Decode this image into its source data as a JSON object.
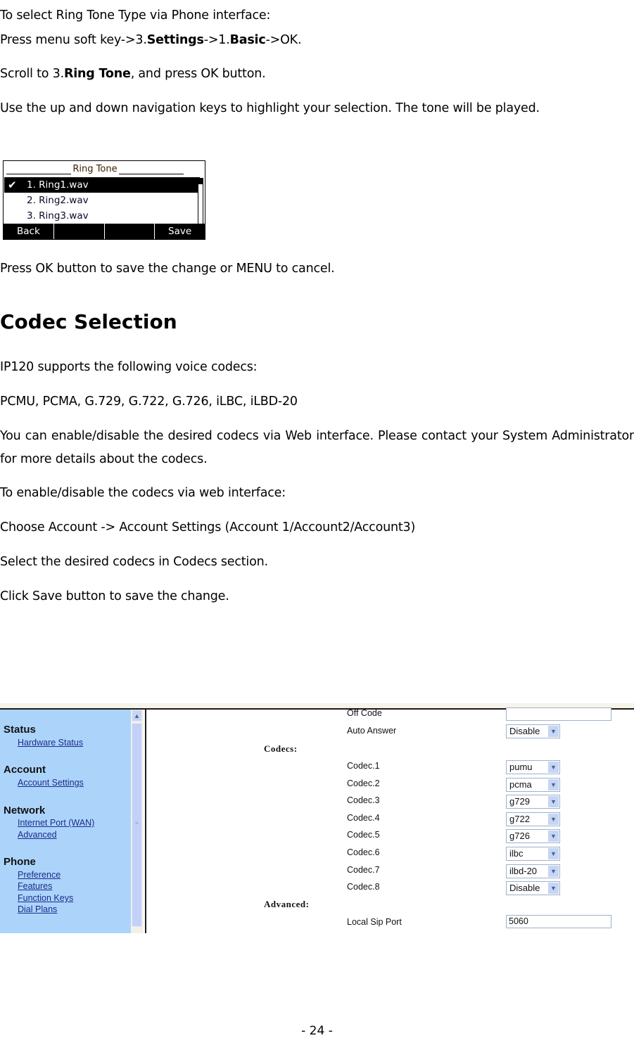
{
  "intro": {
    "line1": "To select Ring Tone Type via Phone interface:",
    "step1": {
      "prefix": "Press menu soft key->3.",
      "b1": "Settings",
      "mid": "->1.",
      "b2": "Basic",
      "suffix": "->OK."
    },
    "step2": {
      "prefix": "Scroll to 3.",
      "b1": "Ring Tone",
      "suffix": ", and press OK button."
    },
    "step3": "Use the up and down navigation keys to highlight your selection. The tone will be played."
  },
  "lcd": {
    "title": "Ring Tone",
    "check_icon": "✔",
    "items": [
      {
        "label": "1. Ring1.wav",
        "selected": true
      },
      {
        "label": "2. Ring2.wav",
        "selected": false
      },
      {
        "label": "3. Ring3.wav",
        "selected": false
      }
    ],
    "softkeys": [
      "Back",
      "",
      "",
      "Save"
    ]
  },
  "after_lcd": "Press OK button to save the change or MENU to cancel.",
  "codec_section": {
    "heading": "Codec Selection",
    "p1": "IP120 supports the following voice codecs:",
    "p2": "PCMU, PCMA, G.729, G.722, G.726, iLBC, iLBD-20",
    "p3": "You can enable/disable the desired codecs via Web interface. Please contact your System Administrator for more details about the codecs.",
    "p4": "To enable/disable the codecs via web interface:",
    "p5": "Choose Account -> Account Settings (Account 1/Account2/Account3)",
    "p6": "Select the desired codecs in Codecs section.",
    "p7": "Click Save button to save the change."
  },
  "web": {
    "nav": [
      {
        "group": "Status",
        "links": [
          "Hardware Status"
        ]
      },
      {
        "group": "Account",
        "links": [
          "Account Settings"
        ]
      },
      {
        "group": "Network",
        "links": [
          "Internet Port (WAN)",
          "Advanced"
        ]
      },
      {
        "group": "Phone",
        "links": [
          "Preference",
          "Features",
          "Function Keys",
          "Dial Plans"
        ]
      }
    ],
    "fields": {
      "off_code": {
        "label": "Off Code",
        "value": ""
      },
      "auto_answer": {
        "label": "Auto Answer",
        "value": "Disable"
      }
    },
    "codecs_label": "Codecs:",
    "codecs": [
      {
        "label": "Codec.1",
        "value": "pumu"
      },
      {
        "label": "Codec.2",
        "value": "pcma"
      },
      {
        "label": "Codec.3",
        "value": "g729"
      },
      {
        "label": "Codec.4",
        "value": "g722"
      },
      {
        "label": "Codec.5",
        "value": "g726"
      },
      {
        "label": "Codec.6",
        "value": "ilbc"
      },
      {
        "label": "Codec.7",
        "value": "ilbd-20"
      },
      {
        "label": "Codec.8",
        "value": "Disable"
      }
    ],
    "advanced_label": "Advanced:",
    "local_sip_port": {
      "label": "Local Sip Port",
      "value": "5060"
    },
    "scroll_up_icon": "▲",
    "dropdown_icon": "▼",
    "grip_icon": "≡",
    "colors": {
      "nav_bg": "#acd4fb",
      "link": "#1a2b8a",
      "dropdown_arrow_bg": "#c5d5f6"
    }
  },
  "footer": {
    "page_number": "- 24 -"
  }
}
